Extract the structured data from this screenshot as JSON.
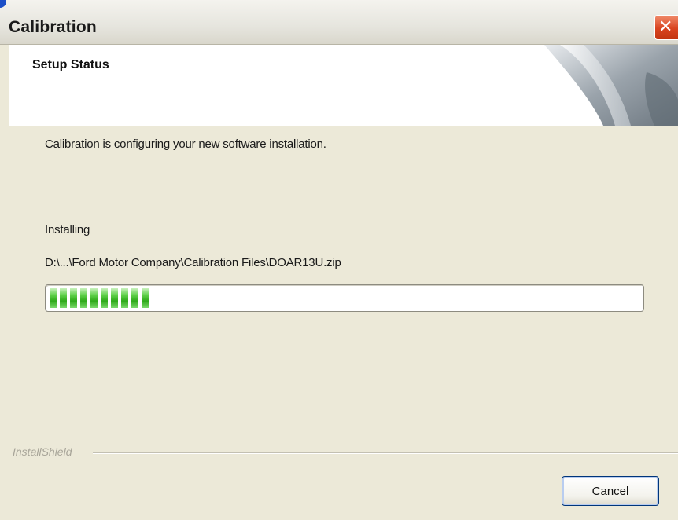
{
  "window": {
    "title": "Calibration"
  },
  "header": {
    "title": "Setup Status"
  },
  "body": {
    "message": "Calibration is configuring your new software installation.",
    "status_label": "Installing",
    "current_file": "D:\\...\\Ford Motor Company\\Calibration Files\\DOAR13U.zip"
  },
  "progress": {
    "fraction": 0.15
  },
  "footer": {
    "brand": "InstallShield",
    "cancel_label": "Cancel"
  },
  "icons": {
    "close": "close-icon"
  },
  "colors": {
    "progress_fill": "#2ea919",
    "close_button": "#d9431f",
    "window_background": "#ece9d8"
  }
}
